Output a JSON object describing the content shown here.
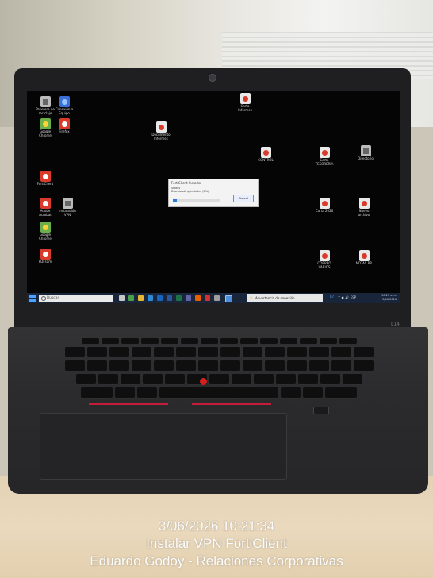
{
  "desktop": {
    "icons": [
      {
        "label": "Papelera de\nreciclaje",
        "style": "gray"
      },
      {
        "label": "Conexión a\nEquipo",
        "style": "blue"
      },
      {
        "label": "Google\nChrome",
        "style": "green"
      },
      {
        "label": "Firefox",
        "style": "red"
      },
      {
        "label": "FortiClient",
        "style": "red"
      },
      {
        "label": "Adobe\nAcrobat",
        "style": "red"
      },
      {
        "label": "Instalación\nVPN",
        "style": "gray"
      },
      {
        "label": "Google\nChrome",
        "style": "green"
      },
      {
        "label": "PDFsam",
        "style": "red"
      },
      {
        "label": "Carta\nInformes",
        "style": ""
      },
      {
        "label": "Documento\nInformes",
        "style": ""
      },
      {
        "label": "CONTROL",
        "style": ""
      },
      {
        "label": "Carta\nTESORERIA",
        "style": ""
      },
      {
        "label": "Directorio",
        "style": "gray"
      },
      {
        "label": "Carta 2026",
        "style": ""
      },
      {
        "label": "Nuevo\narchivo",
        "style": ""
      },
      {
        "label": "CORREO\nVARIOS",
        "style": ""
      },
      {
        "label": "NOTAS RR",
        "style": ""
      }
    ]
  },
  "dialog": {
    "title": "FortiClient Installer",
    "line1": "Status",
    "line2": "Downloading installer (8%)",
    "button": "Cancel",
    "progress": 0.08
  },
  "taskbar": {
    "search_placeholder": "Buscar",
    "notice": "Advertencia de conexión...",
    "tray_icons": "^  ◐  🔊  ESP",
    "tray_badge": "87",
    "clock_time": "10:21 a.m.",
    "clock_date": "3/06/2026"
  },
  "laptop": {
    "brand": "L14"
  },
  "overlay": {
    "timestamp": "3/06/2026 10:21:34",
    "line2": "Instalar VPN FortiClient",
    "line3": "Eduardo Godoy - Relaciones Corporativas"
  }
}
